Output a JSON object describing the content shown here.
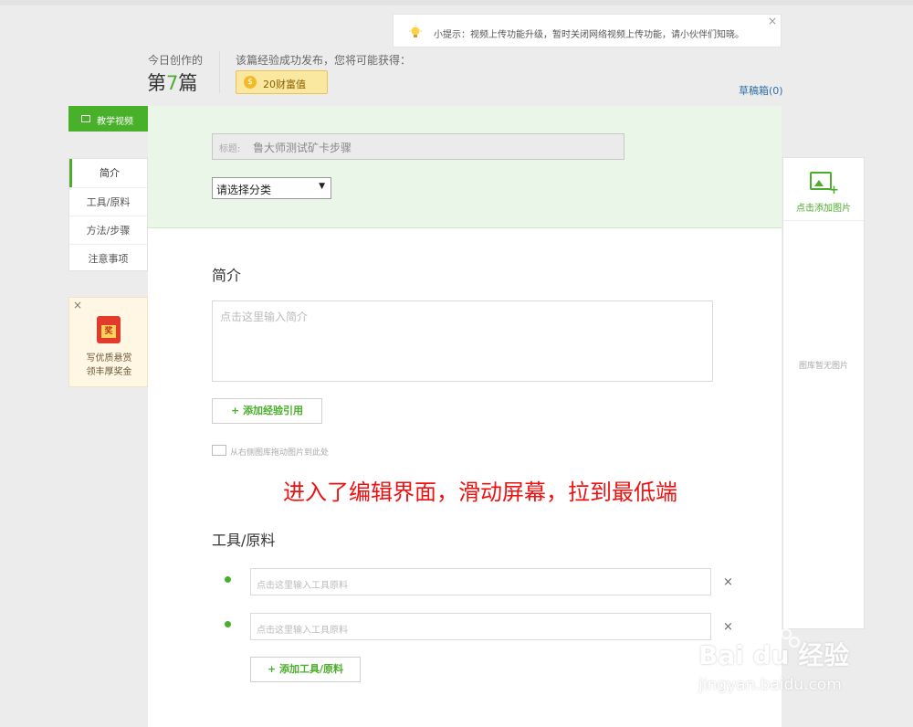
{
  "tip": {
    "text": "小提示：视频上传功能升级，暂时关闭网络视频上传功能，请小伙伴们知晓。",
    "close": "×"
  },
  "today": {
    "label": "今日创作的",
    "prefix": "第",
    "number": "7",
    "suffix": "篇"
  },
  "publish": {
    "note": "该篇经验成功发布，您将可能获得：",
    "reward": "20财富值",
    "coin_glyph": "$"
  },
  "drafts": "草稿箱(0)",
  "video_tab": "教学视频",
  "nav": [
    "简介",
    "工具/原料",
    "方法/步骤",
    "注意事项"
  ],
  "promo": {
    "close": "×",
    "badge": "奖",
    "line1": "写优质悬赏",
    "line2": "领丰厚奖金"
  },
  "editor": {
    "title_label": "标题:",
    "title_value": "鲁大师测试矿卡步骤",
    "category": "请选择分类",
    "intro_heading": "简介",
    "intro_placeholder": "点击这里输入简介",
    "add_ref": "+ 添加经验引用",
    "drag_hint": "从右侧图库拖动图片到此处",
    "tools_heading": "工具/原料",
    "tool_placeholder_1": "点击这里输入工具原料",
    "tool_placeholder_2": "点击这里输入工具原料",
    "remove": "×",
    "add_tool": "+ 添加工具/原料"
  },
  "annotation": "进入了编辑界面，滑动屏幕，拉到最低端",
  "gallery": {
    "add_image": "点击添加图片",
    "empty": "图库暂无图片",
    "plus": "+"
  },
  "watermark": {
    "brand": "Bai du 经验",
    "url": "jingyan.baidu.com"
  },
  "colors": {
    "accent": "#4aae2b",
    "annotation": "#ee1111",
    "link": "#2f6fa7",
    "editor_header": "#eaf7e8"
  },
  "icons": [
    "bulb-icon",
    "coin-icon",
    "video-icon",
    "red-envelope-icon",
    "image-add-icon",
    "image-icon",
    "bullet-dot-icon",
    "close-icon",
    "chevron-down-icon"
  ]
}
